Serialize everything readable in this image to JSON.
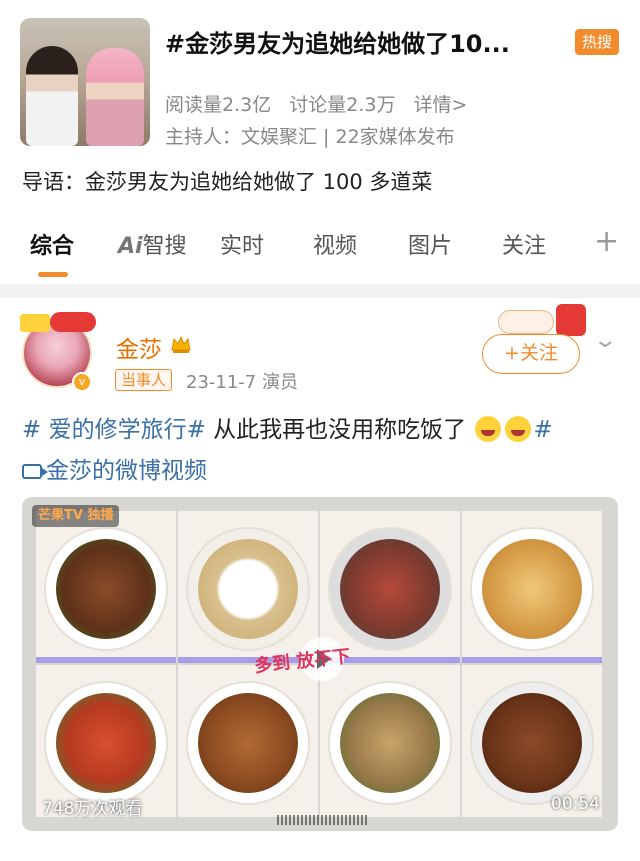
{
  "topic": {
    "title": "#金莎男友为追她给她做了10...",
    "badge": "热搜",
    "reads": "阅读量2.3亿",
    "discussions": "讨论量2.3万",
    "details_link": "详情>",
    "host": "主持人：文娱聚汇 | 22家媒体发布"
  },
  "intro": "导语：金莎男友为追她给她做了 100 多道菜",
  "tabs": [
    {
      "label": "综合",
      "active": true
    },
    {
      "label": "智搜",
      "prefix": "Ai"
    },
    {
      "label": "实时"
    },
    {
      "label": "视频"
    },
    {
      "label": "图片"
    },
    {
      "label": "关注"
    }
  ],
  "tab_plus": "+",
  "post": {
    "username": "金莎",
    "role_badge": "当事人",
    "meta": "23-11-7  演员",
    "follow_label": "+关注",
    "text_hashtag": "# 爱的修学旅行#",
    "text_body": " 从此我再也没用称吃饭了 ",
    "text_tail": "#",
    "video_link_label": "金莎的微博视频"
  },
  "video": {
    "logo": "芒果TV 独播",
    "views": "748万次观看",
    "duration": "00:54",
    "overlay_text": "多到 放不下"
  },
  "colors": {
    "accent": "#f08c2d",
    "username": "#e76f00",
    "link": "#3a6fa8"
  }
}
